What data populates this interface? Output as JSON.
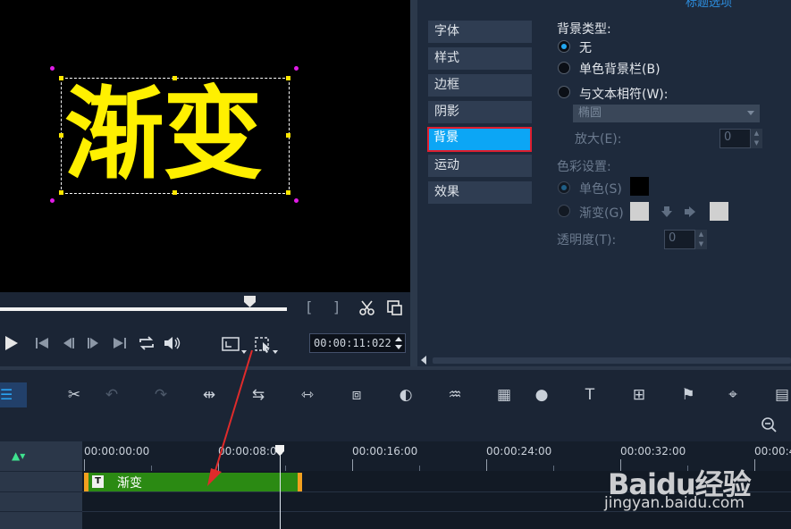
{
  "preview": {
    "title_text": "渐变"
  },
  "player": {
    "timecode": "00:00:11:022",
    "bracket_in": "[",
    "bracket_out": "]"
  },
  "options": {
    "header": "标题选项",
    "tabs": [
      "字体",
      "样式",
      "边框",
      "阴影",
      "背景",
      "运动",
      "效果"
    ],
    "active_tab": "背景",
    "background_type_label": "背景类型:",
    "bg_options": [
      "无",
      "单色背景栏(B)",
      "与文本相符(W):"
    ],
    "bg_selected": "无",
    "shape_dropdown": "椭圆",
    "enlarge_label": "放大(E):",
    "enlarge_value": "0",
    "color_settings_label": "色彩设置:",
    "solid_label": "单色(S)",
    "gradient_label": "渐变(G)",
    "opacity_label": "透明度(T):",
    "opacity_value": "0",
    "colors": {
      "solid_color": "#000000",
      "gradient_from": "#d0d0d0",
      "gradient_to": "#d0d0d0"
    }
  },
  "timeline": {
    "ruler_labels": [
      "00:00:00:00",
      "00:00:08:00",
      "00:00:16:00",
      "00:00:24:00",
      "00:00:32:00",
      "00:00:4"
    ],
    "clip_label": "渐变",
    "clip_type_icon": "T"
  },
  "watermark": {
    "logo": "Baidu经验",
    "url": "jingyan.baidu.com"
  },
  "icons": {
    "play": "play-icon",
    "scissors": "scissors-icon",
    "snapshot": "snapshot-icon",
    "toolbar": [
      "tools-icon",
      "undo-icon",
      "redo-icon",
      "fit-icon",
      "trim-icon",
      "split-icon",
      "extend-icon",
      "color-icon",
      "audio-icon",
      "scene-icon",
      "mask-icon",
      "title-icon",
      "multi-icon",
      "motion-icon",
      "track-icon",
      "timeline-icon"
    ]
  }
}
